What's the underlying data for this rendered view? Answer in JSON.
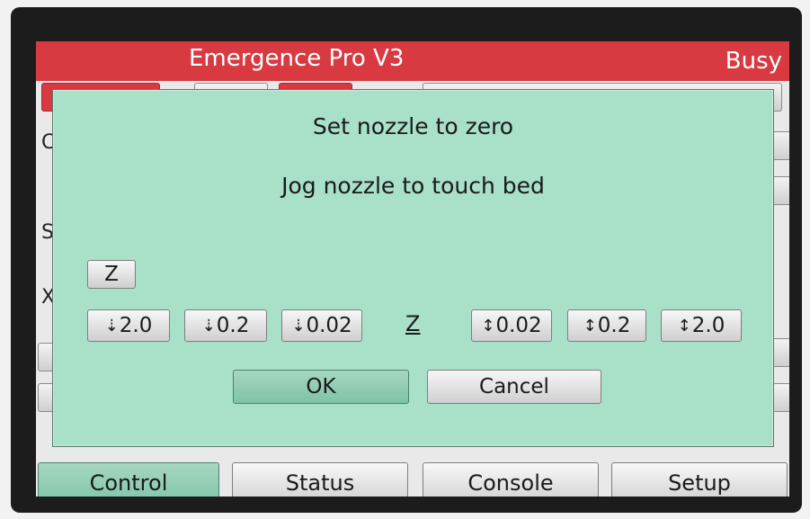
{
  "header": {
    "title": "Emergence Pro V3",
    "status": "Busy"
  },
  "background": {
    "left_letters": [
      "C",
      "S",
      "X"
    ]
  },
  "dialog": {
    "line1": "Set nozzle to zero",
    "line2": "Jog nozzle to touch bed",
    "axis_button": "Z",
    "axis_label": "Z",
    "jog_down": [
      {
        "icon": "⇣",
        "label": "2.0"
      },
      {
        "icon": "⇣",
        "label": "0.2"
      },
      {
        "icon": "⇣",
        "label": "0.02"
      }
    ],
    "jog_up": [
      {
        "icon": "↕",
        "label": "0.02"
      },
      {
        "icon": "↕",
        "label": "0.2"
      },
      {
        "icon": "↕",
        "label": "2.0"
      }
    ],
    "ok_label": "OK",
    "cancel_label": "Cancel"
  },
  "tabs": [
    {
      "label": "Control",
      "active": true
    },
    {
      "label": "Status",
      "active": false
    },
    {
      "label": "Console",
      "active": false
    },
    {
      "label": "Setup",
      "active": false
    }
  ],
  "colors": {
    "title_bar": "#d93a42",
    "dialog_bg": "#a8e0c8",
    "active_green": "#8fcdb2"
  }
}
